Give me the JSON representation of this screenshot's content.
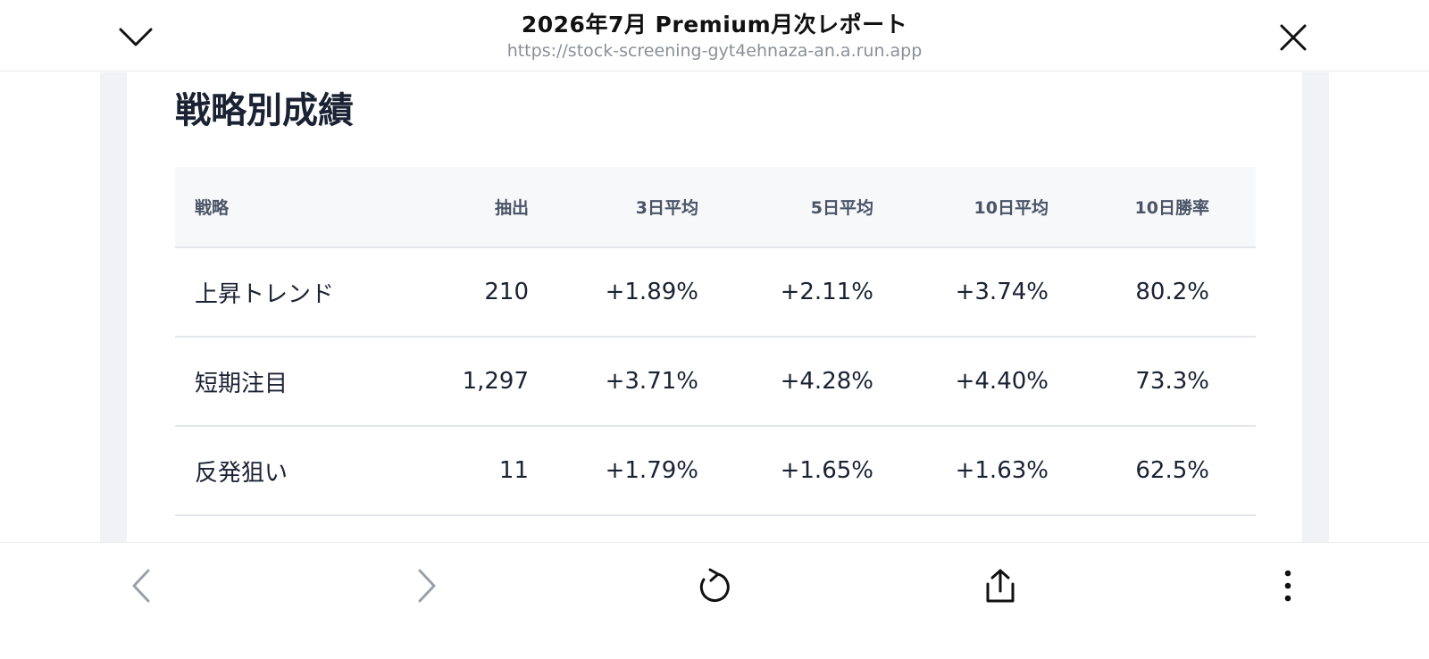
{
  "header": {
    "title": "2026年7月 Premium月次レポート",
    "url": "https://stock-screening-gyt4ehnaza-an.a.run.app"
  },
  "section": {
    "title": "戦略別成績"
  },
  "table": {
    "headers": [
      "戦略",
      "抽出",
      "3日平均",
      "5日平均",
      "10日平均",
      "10日勝率"
    ],
    "rows": [
      [
        "上昇トレンド",
        "210",
        "+1.89%",
        "+2.11%",
        "+3.74%",
        "80.2%"
      ],
      [
        "短期注目",
        "1,297",
        "+3.71%",
        "+4.28%",
        "+4.40%",
        "73.3%"
      ],
      [
        "反発狙い",
        "11",
        "+1.79%",
        "+1.65%",
        "+1.63%",
        "62.5%"
      ]
    ]
  },
  "icons": {
    "collapse": "chevron-down-icon",
    "close": "close-icon",
    "back": "chevron-left-icon",
    "forward": "chevron-right-icon",
    "reload": "reload-icon",
    "share": "share-icon",
    "more": "more-vertical-icon"
  },
  "colors": {
    "text": "#1a2233",
    "header_text": "#4a5466",
    "header_bg": "#f7f8fa",
    "gutter": "#f0f2f5",
    "disabled_icon": "#9aa0a8"
  }
}
